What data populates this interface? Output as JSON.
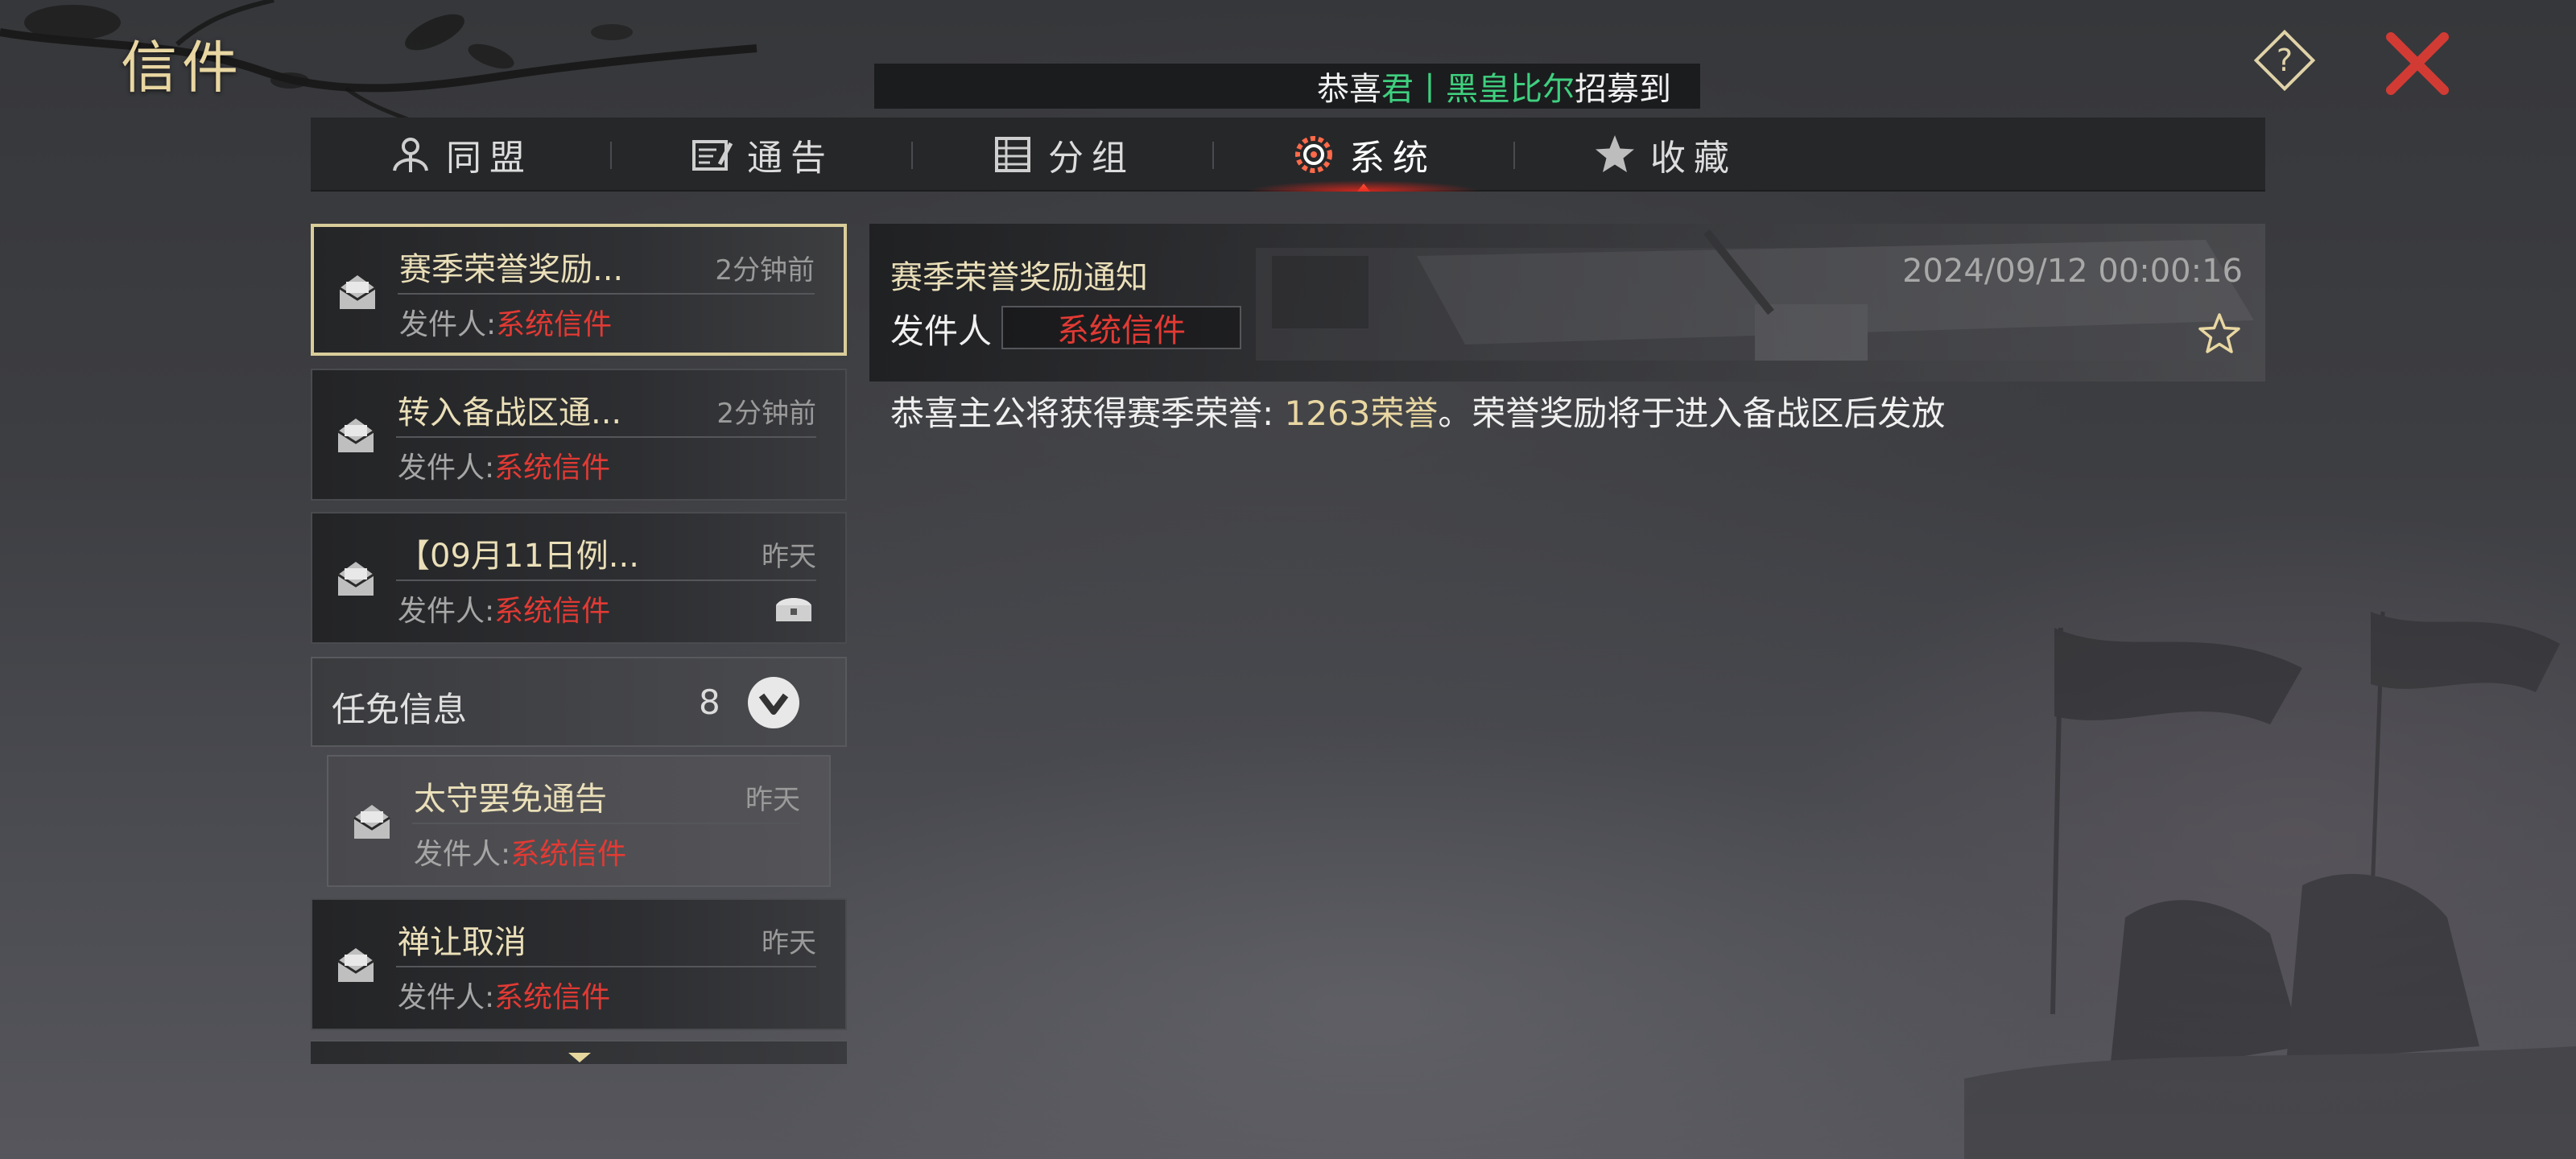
{
  "window": {
    "title": "信件"
  },
  "ticker": {
    "prefix": "恭喜",
    "name": "君丨黑皇比尔",
    "suffix": "招募到"
  },
  "tabs": [
    {
      "label": "同盟",
      "icon": "alliance-icon"
    },
    {
      "label": "通告",
      "icon": "announcement-icon"
    },
    {
      "label": "分组",
      "icon": "group-list-icon"
    },
    {
      "label": "系统",
      "icon": "system-gear-icon",
      "active": true
    },
    {
      "label": "收藏",
      "icon": "star-icon"
    }
  ],
  "mail_list": [
    {
      "subject": "赛季荣誉奖励...",
      "time": "2分钟前",
      "from_label": "发件人:",
      "from": "系统信件",
      "selected": true
    },
    {
      "subject": "转入备战区通...",
      "time": "2分钟前",
      "from_label": "发件人:",
      "from": "系统信件"
    },
    {
      "subject": "【09月11日例...",
      "time": "昨天",
      "from_label": "发件人:",
      "from": "系统信件",
      "has_attachment": true
    }
  ],
  "group": {
    "label": "任免信息",
    "count": "8",
    "expanded": true
  },
  "group_items": [
    {
      "subject": "太守罢免通告",
      "time": "昨天",
      "from_label": "发件人:",
      "from": "系统信件"
    }
  ],
  "mail_list_after": [
    {
      "subject": "禅让取消",
      "time": "昨天",
      "from_label": "发件人:",
      "from": "系统信件"
    }
  ],
  "detail": {
    "subject": "赛季荣誉奖励通知",
    "date": "2024/09/12 00:00:16",
    "from_label": "发件人",
    "from": "系统信件",
    "body_prefix": "恭喜主公将获得赛季荣誉: ",
    "body_highlight": "1263荣誉",
    "body_suffix": "。荣誉奖励将于进入备战区后发放"
  },
  "colors": {
    "gold": "#e9d7a2",
    "sender_red": "#e23a34",
    "ticker_green": "#3fd07f",
    "close_red": "#d23b34"
  }
}
